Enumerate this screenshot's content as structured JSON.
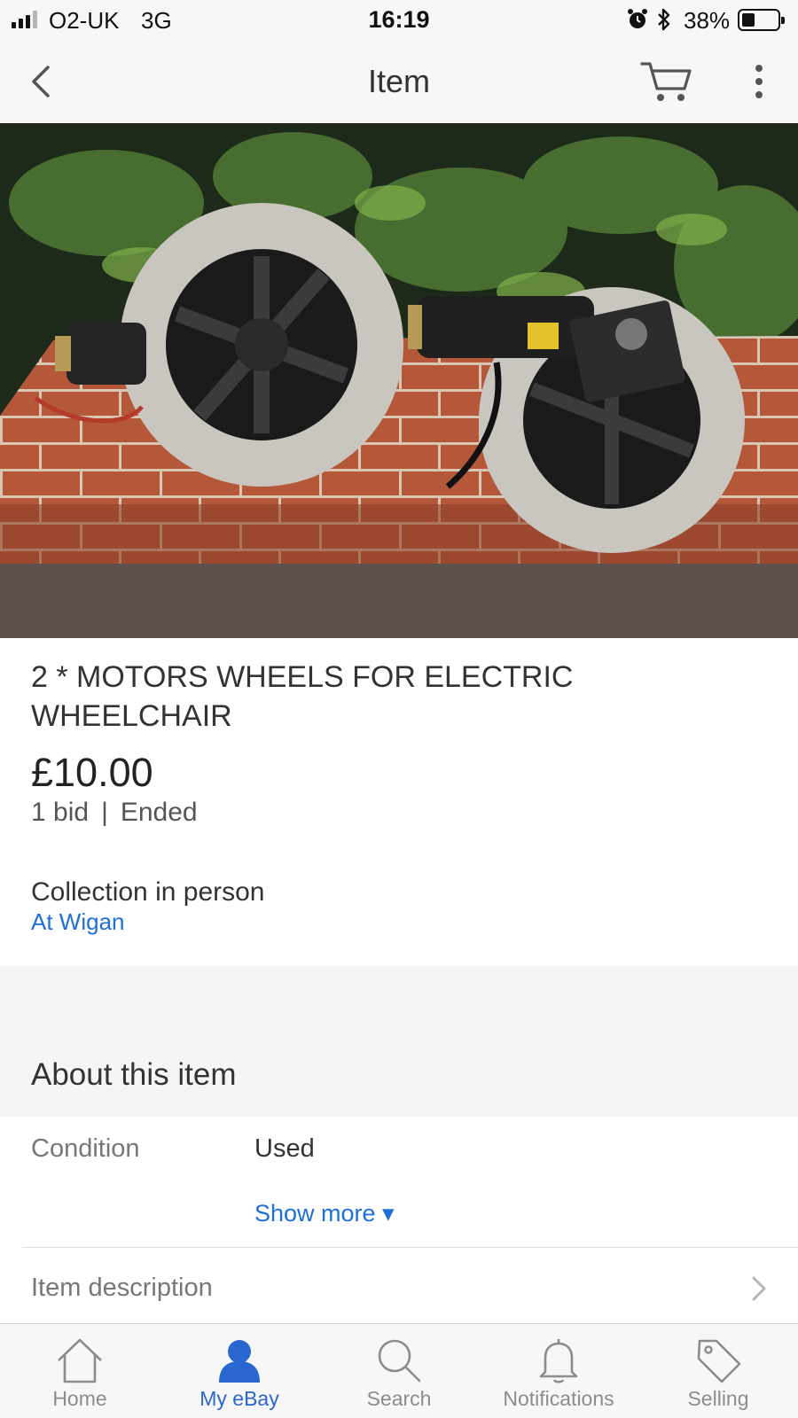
{
  "status_bar": {
    "carrier": "O2-UK",
    "network": "3G",
    "time": "16:19",
    "battery_percent": "38%",
    "battery_level": 0.38,
    "signal_bars_active": 3,
    "signal_bars_total": 4,
    "icons": [
      "signal-icon",
      "alarm-icon",
      "bluetooth-icon",
      "battery-icon"
    ]
  },
  "nav": {
    "title": "Item",
    "icons": [
      "back-chevron-icon",
      "cart-icon",
      "more-vertical-icon"
    ]
  },
  "item": {
    "title": "2 * MOTORS WHEELS FOR ELECTRIC WHEELCHAIR",
    "price": "£10.00",
    "bids": "1 bid",
    "separator": "|",
    "status": "Ended",
    "shipping": "Collection in person",
    "location": "At Wigan"
  },
  "about": {
    "heading": "About this item",
    "condition_label": "Condition",
    "condition_value": "Used",
    "show_more": "Show more ▾",
    "description_label": "Item description"
  },
  "tabs": [
    {
      "label": "Home",
      "icon": "home-icon",
      "active": false
    },
    {
      "label": "My eBay",
      "icon": "person-icon",
      "active": true
    },
    {
      "label": "Search",
      "icon": "search-icon",
      "active": false
    },
    {
      "label": "Notifications",
      "icon": "bell-icon",
      "active": false
    },
    {
      "label": "Selling",
      "icon": "tag-icon",
      "active": false
    }
  ],
  "colors": {
    "link": "#1f6fd8",
    "active_tab": "#2a66cf",
    "inactive_tab": "#8c8c8c",
    "bar_background": "#f7f7f7",
    "section_background": "#f6f5f3"
  }
}
